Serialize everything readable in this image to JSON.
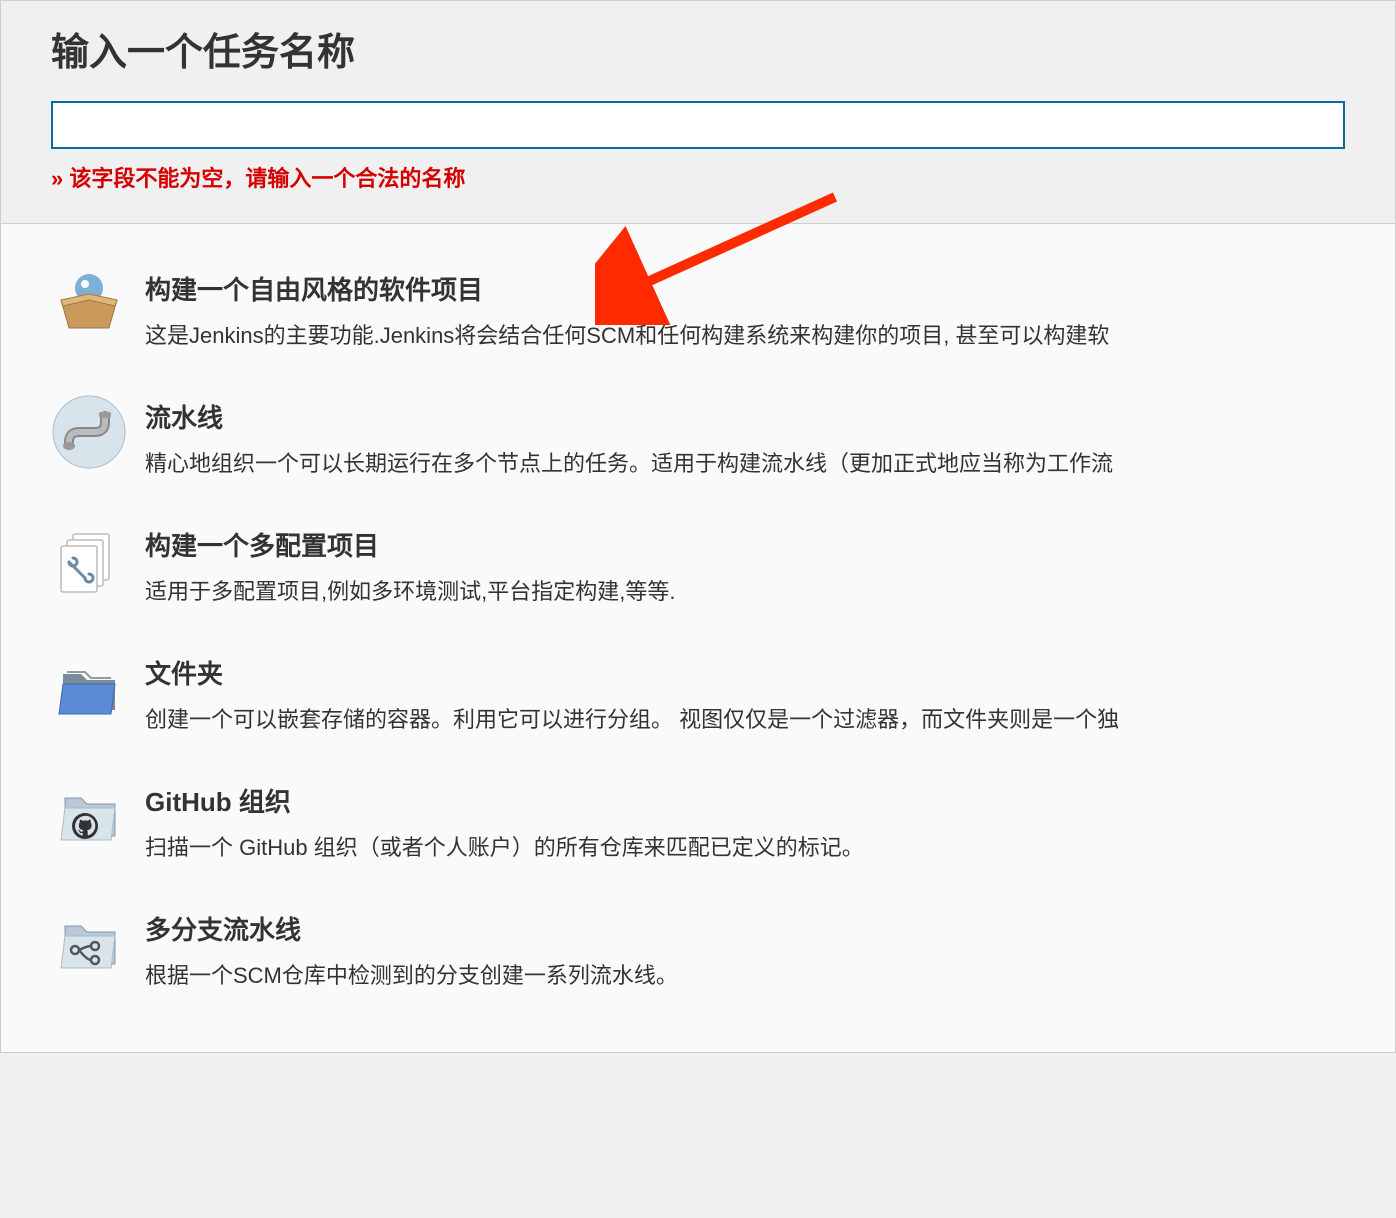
{
  "header": {
    "title": "输入一个任务名称",
    "error": "» 该字段不能为空，请输入一个合法的名称"
  },
  "items": [
    {
      "title": "构建一个自由风格的软件项目",
      "desc": "这是Jenkins的主要功能.Jenkins将会结合任何SCM和任何构建系统来构建你的项目, 甚至可以构建软"
    },
    {
      "title": "流水线",
      "desc": "精心地组织一个可以长期运行在多个节点上的任务。适用于构建流水线（更加正式地应当称为工作流"
    },
    {
      "title": "构建一个多配置项目",
      "desc": "适用于多配置项目,例如多环境测试,平台指定构建,等等."
    },
    {
      "title": "文件夹",
      "desc": "创建一个可以嵌套存储的容器。利用它可以进行分组。  视图仅仅是一个过滤器，而文件夹则是一个独"
    },
    {
      "title": "GitHub 组织",
      "desc": "扫描一个 GitHub 组织（或者个人账户）的所有仓库来匹配已定义的标记。"
    },
    {
      "title": "多分支流水线",
      "desc": "根据一个SCM仓库中检测到的分支创建一系列流水线。"
    }
  ]
}
